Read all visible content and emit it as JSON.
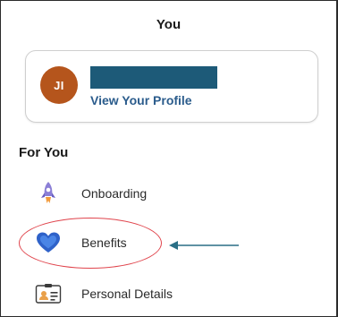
{
  "header": {
    "title": "You"
  },
  "profile": {
    "initials": "JI",
    "view_profile_label": "View Your Profile",
    "avatar_color": "#b5551c",
    "redaction_color": "#1d5a78",
    "link_color": "#2b5c8c"
  },
  "for_you": {
    "title": "For You",
    "items": [
      {
        "label": "Onboarding",
        "icon": "rocket-icon"
      },
      {
        "label": "Benefits",
        "icon": "heart-icon"
      },
      {
        "label": "Personal Details",
        "icon": "id-card-icon"
      }
    ]
  },
  "annotation": {
    "highlight_color": "#e0444c",
    "arrow_color": "#2a6f86"
  }
}
